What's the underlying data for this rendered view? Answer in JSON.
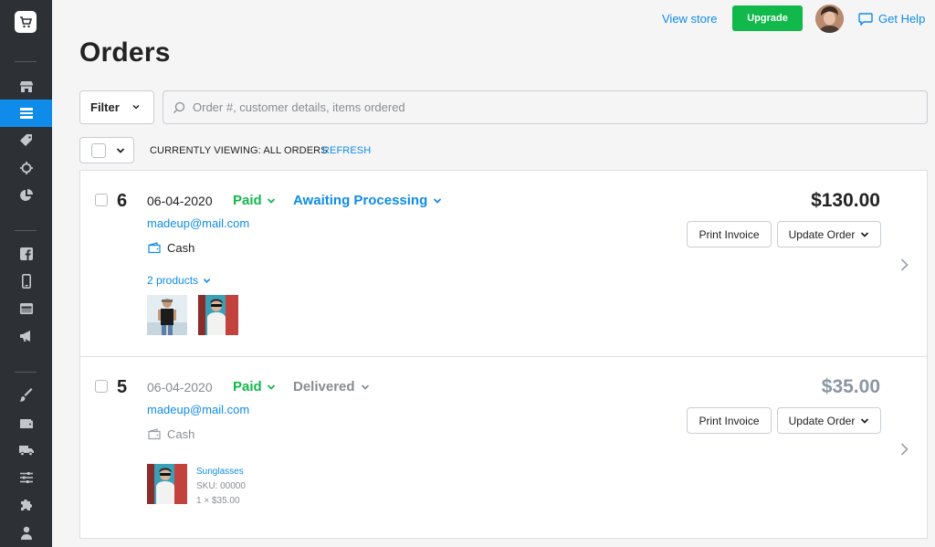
{
  "header": {
    "view_store": "View store",
    "upgrade": "Upgrade",
    "get_help": "Get Help"
  },
  "page": {
    "title": "Orders"
  },
  "filter": {
    "label": "Filter",
    "search_placeholder": "Order #, customer details, items ordered",
    "viewing": "CURRENTLY VIEWING: ALL ORDERS",
    "refresh": "REFRESH"
  },
  "sidebar": {
    "items": [
      {
        "icon": "store-icon"
      },
      {
        "icon": "orders-icon",
        "active": true
      },
      {
        "icon": "tag-icon"
      },
      {
        "icon": "crosshair-icon"
      },
      {
        "icon": "pie-chart-icon"
      },
      {
        "icon": "facebook-icon"
      },
      {
        "icon": "mobile-icon"
      },
      {
        "icon": "browser-icon"
      },
      {
        "icon": "megaphone-icon"
      },
      {
        "icon": "brush-icon"
      },
      {
        "icon": "wallet-icon"
      },
      {
        "icon": "truck-icon"
      },
      {
        "icon": "sliders-icon"
      },
      {
        "icon": "puzzle-icon"
      },
      {
        "icon": "user-icon"
      }
    ]
  },
  "orders": [
    {
      "number": "6",
      "date": "06-04-2020",
      "payment_status": "Paid",
      "fulfillment_status": "Awaiting Processing",
      "email": "madeup@mail.com",
      "payment_method": "Cash",
      "total": "$130.00",
      "print_invoice": "Print Invoice",
      "update_order": "Update Order",
      "products_toggle": "2 products"
    },
    {
      "number": "5",
      "date": "06-04-2020",
      "payment_status": "Paid",
      "fulfillment_status": "Delivered",
      "email": "madeup@mail.com",
      "payment_method": "Cash",
      "total": "$35.00",
      "print_invoice": "Print Invoice",
      "update_order": "Update Order",
      "item": {
        "name": "Sunglasses",
        "sku": "SKU: 00000",
        "qty_price": "1 × $35.00"
      }
    }
  ],
  "colors": {
    "accent": "#0f8ce9",
    "paid": "#10b94a",
    "sidebar": "#2d3136",
    "muted": "#888d92"
  }
}
